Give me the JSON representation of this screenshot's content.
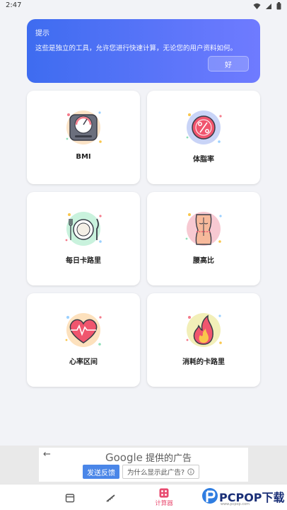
{
  "status": {
    "time": "2:47"
  },
  "tip": {
    "title": "提示",
    "message": "这些是独立的工具，允许您进行快速计算，无论您的用户资料如何。",
    "ok_label": "好",
    "gradient_start": "#3e6cf0",
    "gradient_end": "#6f7bff"
  },
  "tools": [
    {
      "label": "BMI",
      "icon": "scale-gauge-icon"
    },
    {
      "label": "体脂率",
      "icon": "percent-circle-icon"
    },
    {
      "label": "每日卡路里",
      "icon": "plate-cutlery-icon"
    },
    {
      "label": "腰高比",
      "icon": "torso-icon"
    },
    {
      "label": "心率区间",
      "icon": "heart-pulse-icon"
    },
    {
      "label": "消耗的卡路里",
      "icon": "flame-icon"
    }
  ],
  "ad": {
    "brand": "Google",
    "brand_suffix": "提供的广告",
    "feedback_label": "发送反馈",
    "why_label": "为什么显示此广告?"
  },
  "nav": {
    "active_label": "计算器",
    "accent": "#e84a6f"
  },
  "watermark": {
    "brand": "PCPOP下载",
    "url": "www.pcpop.com"
  }
}
